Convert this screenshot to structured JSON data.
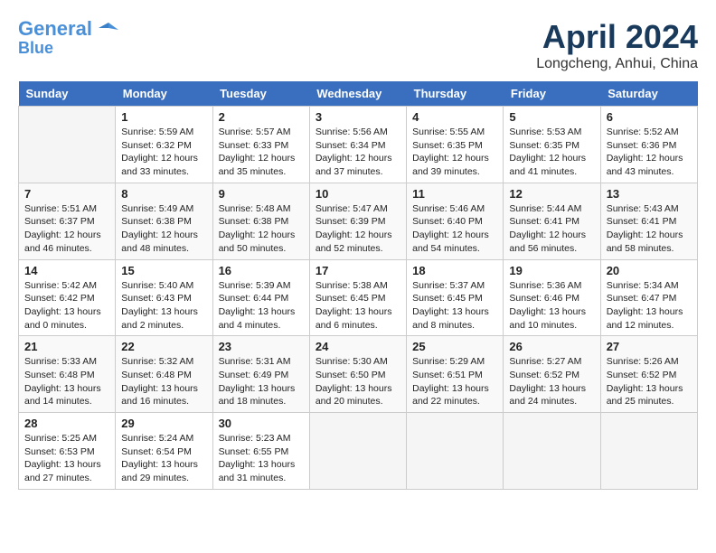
{
  "header": {
    "logo_line1": "General",
    "logo_line2": "Blue",
    "month_title": "April 2024",
    "location": "Longcheng, Anhui, China"
  },
  "weekdays": [
    "Sunday",
    "Monday",
    "Tuesday",
    "Wednesday",
    "Thursday",
    "Friday",
    "Saturday"
  ],
  "weeks": [
    [
      {
        "day": "",
        "info": ""
      },
      {
        "day": "1",
        "info": "Sunrise: 5:59 AM\nSunset: 6:32 PM\nDaylight: 12 hours\nand 33 minutes."
      },
      {
        "day": "2",
        "info": "Sunrise: 5:57 AM\nSunset: 6:33 PM\nDaylight: 12 hours\nand 35 minutes."
      },
      {
        "day": "3",
        "info": "Sunrise: 5:56 AM\nSunset: 6:34 PM\nDaylight: 12 hours\nand 37 minutes."
      },
      {
        "day": "4",
        "info": "Sunrise: 5:55 AM\nSunset: 6:35 PM\nDaylight: 12 hours\nand 39 minutes."
      },
      {
        "day": "5",
        "info": "Sunrise: 5:53 AM\nSunset: 6:35 PM\nDaylight: 12 hours\nand 41 minutes."
      },
      {
        "day": "6",
        "info": "Sunrise: 5:52 AM\nSunset: 6:36 PM\nDaylight: 12 hours\nand 43 minutes."
      }
    ],
    [
      {
        "day": "7",
        "info": "Sunrise: 5:51 AM\nSunset: 6:37 PM\nDaylight: 12 hours\nand 46 minutes."
      },
      {
        "day": "8",
        "info": "Sunrise: 5:49 AM\nSunset: 6:38 PM\nDaylight: 12 hours\nand 48 minutes."
      },
      {
        "day": "9",
        "info": "Sunrise: 5:48 AM\nSunset: 6:38 PM\nDaylight: 12 hours\nand 50 minutes."
      },
      {
        "day": "10",
        "info": "Sunrise: 5:47 AM\nSunset: 6:39 PM\nDaylight: 12 hours\nand 52 minutes."
      },
      {
        "day": "11",
        "info": "Sunrise: 5:46 AM\nSunset: 6:40 PM\nDaylight: 12 hours\nand 54 minutes."
      },
      {
        "day": "12",
        "info": "Sunrise: 5:44 AM\nSunset: 6:41 PM\nDaylight: 12 hours\nand 56 minutes."
      },
      {
        "day": "13",
        "info": "Sunrise: 5:43 AM\nSunset: 6:41 PM\nDaylight: 12 hours\nand 58 minutes."
      }
    ],
    [
      {
        "day": "14",
        "info": "Sunrise: 5:42 AM\nSunset: 6:42 PM\nDaylight: 13 hours\nand 0 minutes."
      },
      {
        "day": "15",
        "info": "Sunrise: 5:40 AM\nSunset: 6:43 PM\nDaylight: 13 hours\nand 2 minutes."
      },
      {
        "day": "16",
        "info": "Sunrise: 5:39 AM\nSunset: 6:44 PM\nDaylight: 13 hours\nand 4 minutes."
      },
      {
        "day": "17",
        "info": "Sunrise: 5:38 AM\nSunset: 6:45 PM\nDaylight: 13 hours\nand 6 minutes."
      },
      {
        "day": "18",
        "info": "Sunrise: 5:37 AM\nSunset: 6:45 PM\nDaylight: 13 hours\nand 8 minutes."
      },
      {
        "day": "19",
        "info": "Sunrise: 5:36 AM\nSunset: 6:46 PM\nDaylight: 13 hours\nand 10 minutes."
      },
      {
        "day": "20",
        "info": "Sunrise: 5:34 AM\nSunset: 6:47 PM\nDaylight: 13 hours\nand 12 minutes."
      }
    ],
    [
      {
        "day": "21",
        "info": "Sunrise: 5:33 AM\nSunset: 6:48 PM\nDaylight: 13 hours\nand 14 minutes."
      },
      {
        "day": "22",
        "info": "Sunrise: 5:32 AM\nSunset: 6:48 PM\nDaylight: 13 hours\nand 16 minutes."
      },
      {
        "day": "23",
        "info": "Sunrise: 5:31 AM\nSunset: 6:49 PM\nDaylight: 13 hours\nand 18 minutes."
      },
      {
        "day": "24",
        "info": "Sunrise: 5:30 AM\nSunset: 6:50 PM\nDaylight: 13 hours\nand 20 minutes."
      },
      {
        "day": "25",
        "info": "Sunrise: 5:29 AM\nSunset: 6:51 PM\nDaylight: 13 hours\nand 22 minutes."
      },
      {
        "day": "26",
        "info": "Sunrise: 5:27 AM\nSunset: 6:52 PM\nDaylight: 13 hours\nand 24 minutes."
      },
      {
        "day": "27",
        "info": "Sunrise: 5:26 AM\nSunset: 6:52 PM\nDaylight: 13 hours\nand 25 minutes."
      }
    ],
    [
      {
        "day": "28",
        "info": "Sunrise: 5:25 AM\nSunset: 6:53 PM\nDaylight: 13 hours\nand 27 minutes."
      },
      {
        "day": "29",
        "info": "Sunrise: 5:24 AM\nSunset: 6:54 PM\nDaylight: 13 hours\nand 29 minutes."
      },
      {
        "day": "30",
        "info": "Sunrise: 5:23 AM\nSunset: 6:55 PM\nDaylight: 13 hours\nand 31 minutes."
      },
      {
        "day": "",
        "info": ""
      },
      {
        "day": "",
        "info": ""
      },
      {
        "day": "",
        "info": ""
      },
      {
        "day": "",
        "info": ""
      }
    ]
  ]
}
